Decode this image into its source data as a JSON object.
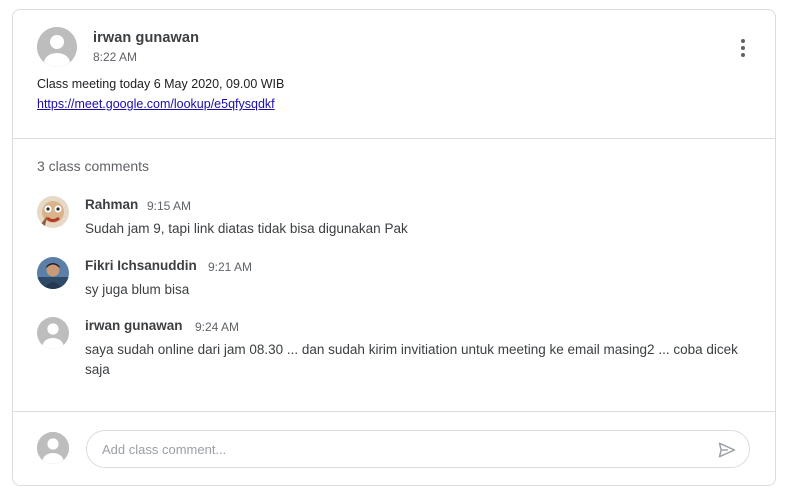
{
  "post": {
    "author": "irwan gunawan",
    "time": "8:22 AM",
    "text": "Class meeting today 6 May 2020, 09.00 WIB",
    "link": "https://meet.google.com/lookup/e5qfysqdkf",
    "menu_icon": "more-vert-icon"
  },
  "comments_section": {
    "count_label": "3 class comments",
    "comments": [
      {
        "author": "Rahman",
        "time": "9:15 AM",
        "text": "Sudah jam 9, tapi link diatas tidak bisa digunakan Pak"
      },
      {
        "author": "Fikri Ichsanuddin",
        "time": "9:21 AM",
        "text": "sy juga blum bisa"
      },
      {
        "author": "irwan gunawan",
        "time": "9:24 AM",
        "text_lines": [
          "saya sudah online dari jam 08.30 ... dan sudah kirim invitiation untuk meeting ke email masing2 ... coba dicek",
          "saja"
        ]
      }
    ]
  },
  "composer": {
    "placeholder": "Add class comment...",
    "send_icon": "send-icon"
  },
  "colors": {
    "border": "#dadce0",
    "link": "#1a0dab",
    "text_primary": "#3c4043",
    "text_secondary": "#5f6368",
    "avatar_default": "#bdbdbd"
  }
}
